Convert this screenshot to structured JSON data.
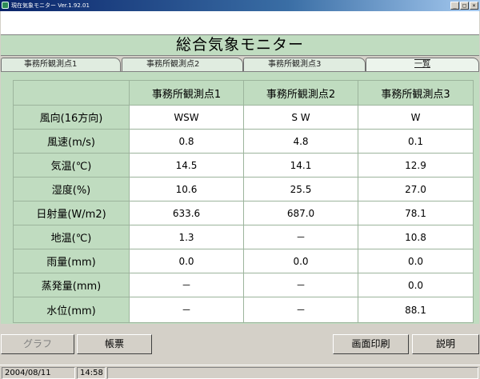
{
  "window": {
    "title": "現在気象モニター Ver.1.92.01",
    "controls": [
      "_",
      "□",
      "×"
    ]
  },
  "banner": {
    "title": "総合気象モニター"
  },
  "tabs": [
    {
      "label": "事務所観測点1"
    },
    {
      "label": "事務所観測点2"
    },
    {
      "label": "事務所観測点3"
    },
    {
      "label": "一覧",
      "active": true
    }
  ],
  "table": {
    "columns": [
      "事務所観測点1",
      "事務所観測点2",
      "事務所観測点3"
    ],
    "rows": [
      {
        "label": "風向(16方向)",
        "values": [
          "WSW",
          "S W",
          "W"
        ]
      },
      {
        "label": "風速(m/s)",
        "values": [
          "0.8",
          "4.8",
          "0.1"
        ]
      },
      {
        "label": "気温(℃)",
        "values": [
          "14.5",
          "14.1",
          "12.9"
        ]
      },
      {
        "label": "湿度(%)",
        "values": [
          "10.6",
          "25.5",
          "27.0"
        ]
      },
      {
        "label": "日射量(W/m2)",
        "values": [
          "633.6",
          "687.0",
          "78.1"
        ]
      },
      {
        "label": "地温(℃)",
        "values": [
          "1.3",
          "－",
          "10.8"
        ]
      },
      {
        "label": "雨量(mm)",
        "values": [
          "0.0",
          "0.0",
          "0.0"
        ]
      },
      {
        "label": "蒸発量(mm)",
        "values": [
          "－",
          "－",
          "0.0"
        ]
      },
      {
        "label": "水位(mm)",
        "values": [
          "－",
          "－",
          "88.1"
        ]
      }
    ]
  },
  "buttons": {
    "graph": "グラフ",
    "report": "帳票",
    "print": "画面印刷",
    "help": "説明"
  },
  "status": {
    "date": "2004/08/11",
    "time": "14:58"
  },
  "colors": {
    "panel": "#c0dcc0",
    "titlebar": "#0a246a"
  }
}
